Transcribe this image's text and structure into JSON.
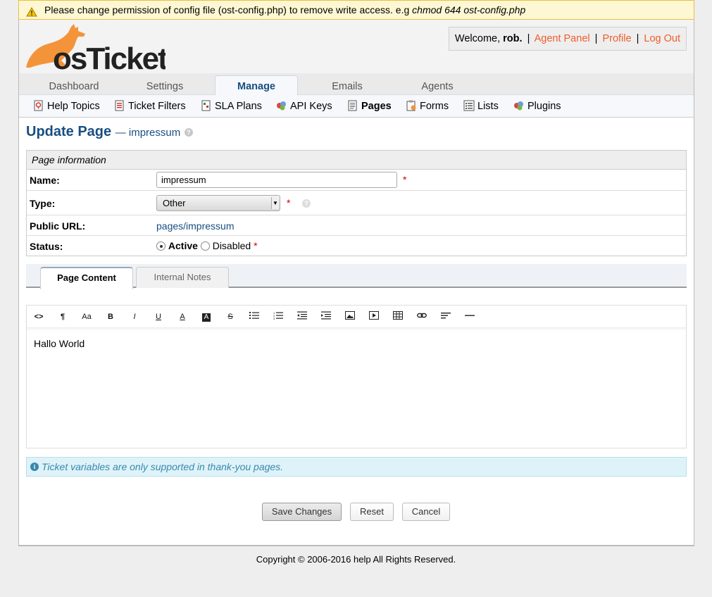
{
  "warning": {
    "text": "Please change permission of config file (ost-config.php) to remove write access. e.g ",
    "command": "chmod 644 ost-config.php"
  },
  "logo": {
    "text": "osTicket"
  },
  "user": {
    "welcome": "Welcome, ",
    "name": "rob",
    "name_suffix": ".",
    "agent_panel": "Agent Panel",
    "profile": "Profile",
    "logout": "Log Out",
    "sep": "|"
  },
  "nav": {
    "tabs": [
      "Dashboard",
      "Settings",
      "Manage",
      "Emails",
      "Agents"
    ],
    "active": "Manage"
  },
  "subnav": {
    "items": [
      "Help Topics",
      "Ticket Filters",
      "SLA Plans",
      "API Keys",
      "Pages",
      "Forms",
      "Lists",
      "Plugins"
    ],
    "active": "Pages"
  },
  "page": {
    "title": "Update Page",
    "subtitle": "— impressum"
  },
  "form": {
    "section": "Page information",
    "name_label": "Name:",
    "name_value": "impressum",
    "type_label": "Type:",
    "type_value": "Other",
    "url_label": "Public URL:",
    "url_value": "pages/impressum",
    "status_label": "Status:",
    "status_active": "Active",
    "status_disabled": "Disabled",
    "required": "*"
  },
  "content_tabs": [
    "Page Content",
    "Internal Notes"
  ],
  "editor": {
    "toolbar": [
      "html",
      "format",
      "font-size",
      "bold",
      "italic",
      "underline",
      "font-color",
      "back-color",
      "strikethrough",
      "unordered-list",
      "ordered-list",
      "outdent",
      "indent",
      "image",
      "video",
      "table",
      "link",
      "align",
      "horizontal-rule"
    ],
    "body": "Hallo World"
  },
  "info": "Ticket variables are only supported in thank-you pages.",
  "buttons": {
    "save": "Save Changes",
    "reset": "Reset",
    "cancel": "Cancel"
  },
  "footer": "Copyright © 2006-2016 help All Rights Reserved.",
  "colors": {
    "brand_blue": "#184e81",
    "logo_orange": "#f4943a",
    "link_orange": "#f05d2b",
    "required_red": "#cc0000",
    "info_blue": "#3a87ad"
  }
}
